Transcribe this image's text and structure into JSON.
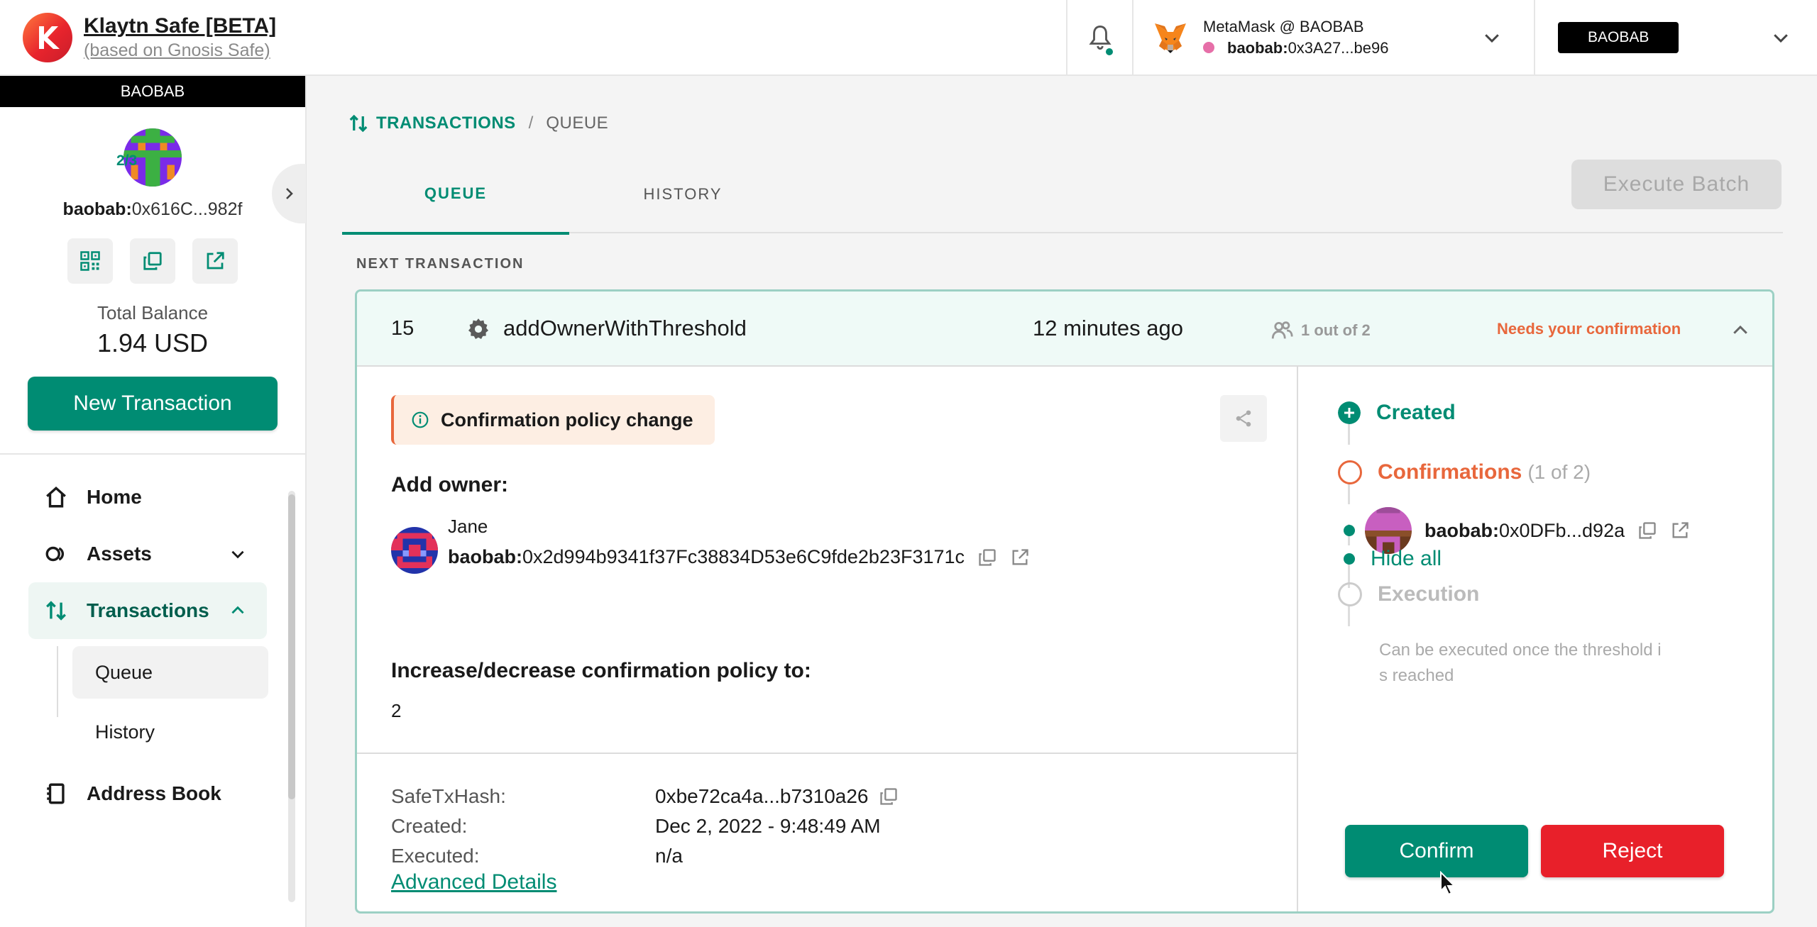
{
  "header": {
    "app_title": "Klaytn Safe [BETA]",
    "app_subtitle": "(based on Gnosis Safe)",
    "wallet_name": "MetaMask @ BAOBAB",
    "wallet_addr_prefix": "baobab:",
    "wallet_addr": "0x3A27...be96",
    "network": "BAOBAB"
  },
  "sidebar": {
    "network_strip": "BAOBAB",
    "threshold": "2/3",
    "safe_addr_prefix": "baobab:",
    "safe_addr": "0x616C...982f",
    "balance_label": "Total Balance",
    "balance_value": "1.94 USD",
    "new_tx_label": "New Transaction",
    "nav": {
      "home": "Home",
      "assets": "Assets",
      "transactions": "Transactions",
      "queue": "Queue",
      "history": "History",
      "address_book": "Address Book"
    }
  },
  "main": {
    "breadcrumb_main": "TRANSACTIONS",
    "breadcrumb_sep": "/",
    "breadcrumb_sub": "QUEUE",
    "tab_queue": "QUEUE",
    "tab_history": "HISTORY",
    "execute_batch": "Execute Batch",
    "next_label": "NEXT TRANSACTION"
  },
  "tx": {
    "nonce": "15",
    "method": "addOwnerWithThreshold",
    "time": "12 minutes ago",
    "owners": "1 out of 2",
    "status": "Needs your confirmation",
    "policy_tag": "Confirmation policy change",
    "add_owner_label": "Add owner:",
    "owner_name": "Jane",
    "owner_prefix": "baobab:",
    "owner_address": "0x2d994b9341f37Fc38834D53e6C9fde2b23F3171c",
    "policy_heading": "Increase/decrease confirmation policy to:",
    "policy_value": "2",
    "meta": {
      "hash_label": "SafeTxHash:",
      "hash_value": "0xbe72ca4a...b7310a26",
      "created_label": "Created:",
      "created_value": "Dec 2, 2022 - 9:48:49 AM",
      "executed_label": "Executed:",
      "executed_value": "n/a"
    },
    "advanced_details": "Advanced Details"
  },
  "timeline": {
    "created": "Created",
    "confirmations": "Confirmations",
    "confirmations_count": "(1 of 2)",
    "signer_prefix": "baobab:",
    "signer_addr": "0x0DFb...d92a",
    "hide_all": "Hide all",
    "execution": "Execution",
    "execution_note_1": "Can be executed once the threshold i",
    "execution_note_2": "s reached",
    "confirm": "Confirm",
    "reject": "Reject"
  },
  "colors": {
    "primary": "#008c73",
    "warning": "#e8673c",
    "danger": "#e8202a",
    "card_border": "#9cd0c4"
  },
  "icons": [
    "klaytn-logo",
    "bell-icon",
    "metamask-fox-icon",
    "chevron-down-icon",
    "chevron-right-icon",
    "qr-code-icon",
    "copy-icon",
    "external-link-icon",
    "home-icon",
    "assets-icon",
    "transactions-icon",
    "chevron-up-icon",
    "address-book-icon",
    "gear-icon",
    "owners-icon",
    "info-icon",
    "share-icon",
    "plus-circle-icon"
  ]
}
